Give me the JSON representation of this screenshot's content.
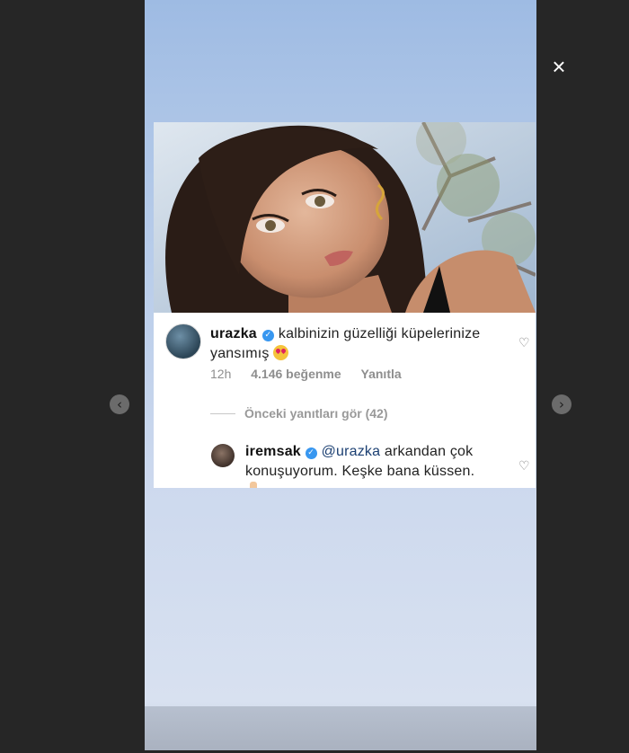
{
  "viewer": {
    "close_icon": "×",
    "prev_icon": "‹",
    "next_icon": "›"
  },
  "post": {
    "comment": {
      "username": "urazka",
      "text": "kalbinizin güzelliği küpelerinize yansımış",
      "emoji": "heart-eyes",
      "time": "12h",
      "likes": "4.146 beğenme",
      "reply_label": "Yanıtla"
    },
    "previous_replies_label": "Önceki yanıtları gör (42)",
    "reply": {
      "username": "iremsak",
      "mention": "@urazka",
      "text": "arkandan çok konuşuyorum. Keşke bana küssen."
    }
  },
  "colors": {
    "verified": "#3897f0",
    "story_sky": "#a9c2e6",
    "viewer_background": "#262626"
  }
}
